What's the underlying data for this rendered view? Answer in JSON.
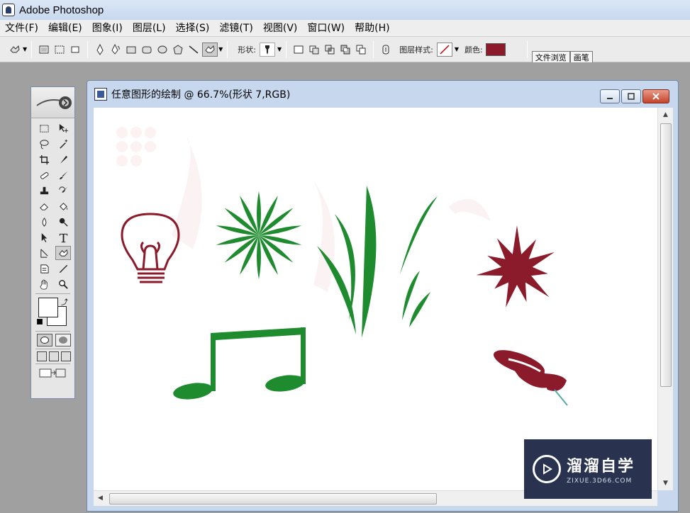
{
  "app": {
    "title": "Adobe Photoshop"
  },
  "menu": [
    "文件(F)",
    "编辑(E)",
    "图象(I)",
    "图层(L)",
    "选择(S)",
    "滤镜(T)",
    "视图(V)",
    "窗口(W)",
    "帮助(H)"
  ],
  "options": {
    "shape_label": "形状:",
    "layer_style_label": "图层样式:",
    "color_label": "颜色:",
    "color_value": "#8b1a2b",
    "tabs": [
      "文件浏览",
      "画笔"
    ]
  },
  "document": {
    "title": "任意图形的绘制 @ 66.7%(形状 7,RGB)"
  },
  "shapes": {
    "green": "#1e8b2e",
    "red": "#8b1a2b"
  },
  "watermark": {
    "main": "溜溜自学",
    "sub": "ZIXUE.3D66.COM"
  }
}
